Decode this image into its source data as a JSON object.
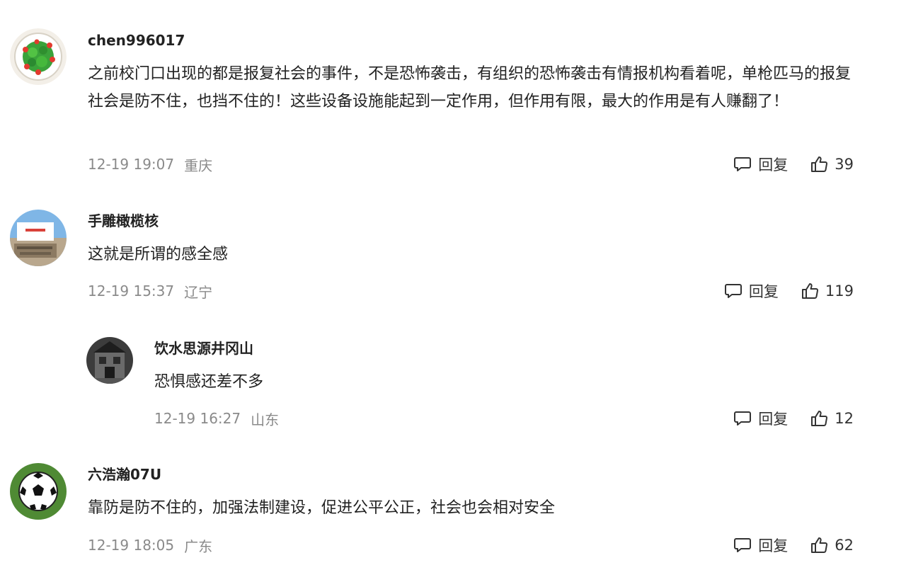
{
  "comments": [
    {
      "username": "chen996017",
      "content": "之前校门口出现的都是报复社会的事件，不是恐怖袭击，有组织的恐怖袭击有情报机构看着呢，单枪匹马的报复社会是防不住，也挡不住的！这些设备设施能起到一定作用，但作用有限，最大的作用是有人赚翻了！",
      "time": "12-19 19:07",
      "location": "重庆",
      "reply_label": "回复",
      "likes": "39",
      "avatar": "green-salad-avatar"
    },
    {
      "username": "手雕橄榄核",
      "content": "这就是所谓的感全感",
      "time": "12-19 15:37",
      "location": "辽宁",
      "reply_label": "回复",
      "likes": "119",
      "avatar": "building-photo-avatar"
    },
    {
      "username": "饮水思源井冈山",
      "content": "恐惧感还差不多",
      "time": "12-19 16:27",
      "location": "山东",
      "reply_label": "回复",
      "likes": "12",
      "avatar": "building-dark-avatar"
    },
    {
      "username": "六浩瀚07U",
      "content": "靠防是防不住的，加强法制建设，促进公平公正，社会也会相对安全",
      "time": "12-19 18:05",
      "location": "广东",
      "reply_label": "回复",
      "likes": "62",
      "avatar": "soccer-ball-avatar"
    }
  ],
  "colors": {
    "text": "#222222",
    "meta": "#8a8a8a",
    "background": "#ffffff"
  }
}
